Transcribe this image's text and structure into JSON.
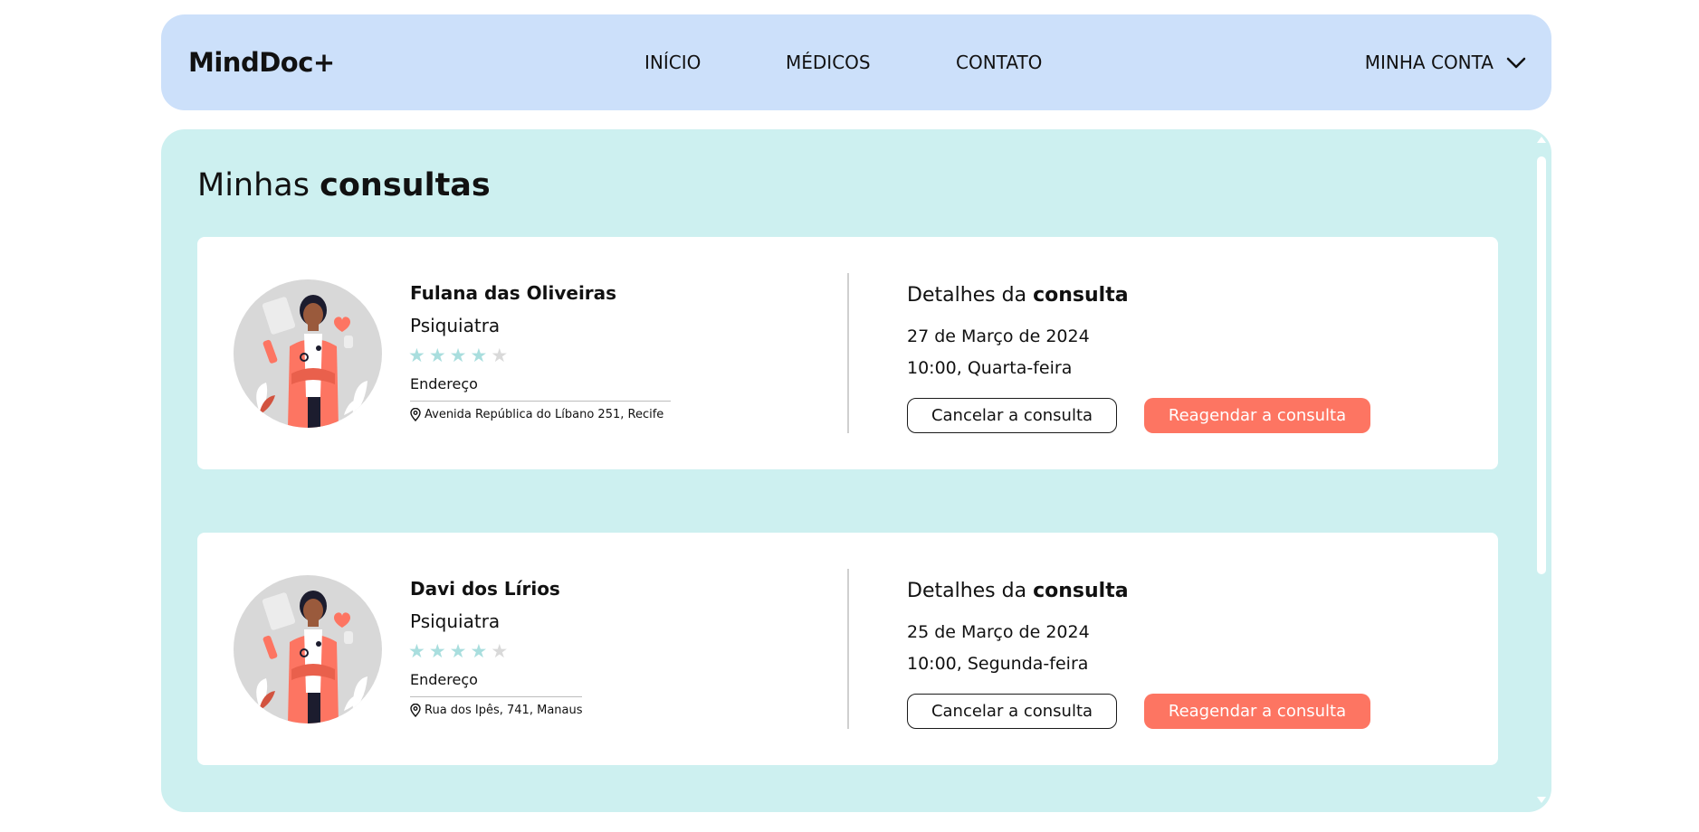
{
  "header": {
    "logo": "MindDoc+",
    "nav": [
      "INÍCIO",
      "MÉDICOS",
      "CONTATO"
    ],
    "account_label": "MINHA CONTA",
    "account_icon": "chevron-down-icon"
  },
  "main": {
    "title_regular": "Minhas ",
    "title_bold": "consultas",
    "appointments": [
      {
        "doctor_name": "Fulana das Oliveiras",
        "specialty": "Psiquiatra",
        "rating": 4,
        "rating_max": 5,
        "address_label": "Endereço",
        "address": "Avenida República do Líbano 251, Recife",
        "details_title_regular": "Detalhes da ",
        "details_title_bold": "consulta",
        "date": "27 de Março de 2024",
        "time": "10:00, Quarta-feira",
        "cancel_label": "Cancelar a consulta",
        "reschedule_label": "Reagendar a consulta"
      },
      {
        "doctor_name": "Davi dos Lírios",
        "specialty": "Psiquiatra",
        "rating": 4,
        "rating_max": 5,
        "address_label": "Endereço",
        "address": "Rua dos Ipês, 741, Manaus",
        "details_title_regular": "Detalhes da ",
        "details_title_bold": "consulta",
        "date": "25 de Março de 2024",
        "time": "10:00, Segunda-feira",
        "cancel_label": "Cancelar a consulta",
        "reschedule_label": "Reagendar a consulta"
      }
    ]
  },
  "colors": {
    "navbar_bg": "#cce0fa",
    "panel_bg": "#cdf0f0",
    "accent": "#fd7562",
    "star_on": "#a9dede",
    "star_off": "#d9d9d9"
  }
}
